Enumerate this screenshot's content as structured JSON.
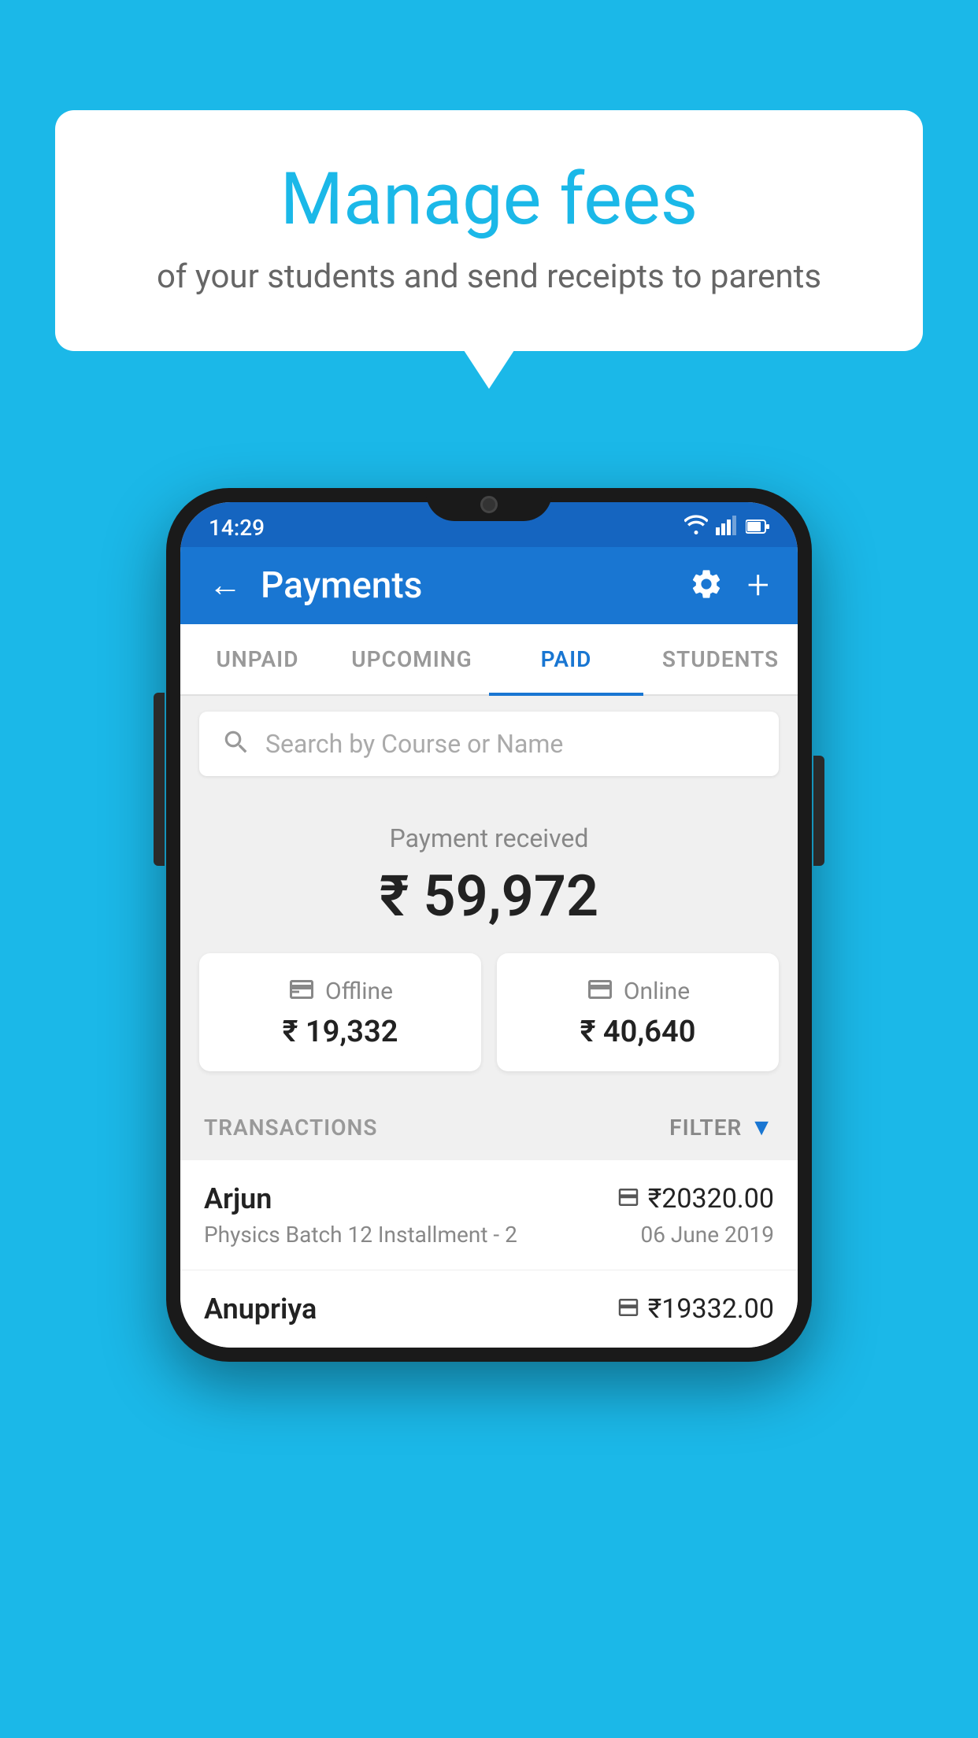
{
  "background_color": "#1BB8E8",
  "speech_bubble": {
    "title": "Manage fees",
    "subtitle": "of your students and send receipts to parents"
  },
  "phone": {
    "status_bar": {
      "time": "14:29",
      "wifi_icon": "▾",
      "signal_icon": "▲",
      "battery_icon": "▪"
    },
    "header": {
      "back_label": "←",
      "title": "Payments",
      "gear_label": "⚙",
      "plus_label": "+"
    },
    "tabs": [
      {
        "id": "unpaid",
        "label": "UNPAID",
        "active": false
      },
      {
        "id": "upcoming",
        "label": "UPCOMING",
        "active": false
      },
      {
        "id": "paid",
        "label": "PAID",
        "active": true
      },
      {
        "id": "students",
        "label": "STUDENTS",
        "active": false
      }
    ],
    "search": {
      "placeholder": "Search by Course or Name"
    },
    "payment_summary": {
      "label": "Payment received",
      "amount": "₹ 59,972",
      "offline": {
        "label": "Offline",
        "amount": "₹ 19,332"
      },
      "online": {
        "label": "Online",
        "amount": "₹ 40,640"
      }
    },
    "transactions": {
      "label": "TRANSACTIONS",
      "filter_label": "FILTER",
      "items": [
        {
          "name": "Arjun",
          "amount": "₹20320.00",
          "description": "Physics Batch 12 Installment - 2",
          "date": "06 June 2019",
          "payment_type": "online"
        },
        {
          "name": "Anupriya",
          "amount": "₹19332.00",
          "description": "",
          "date": "",
          "payment_type": "offline"
        }
      ]
    }
  }
}
